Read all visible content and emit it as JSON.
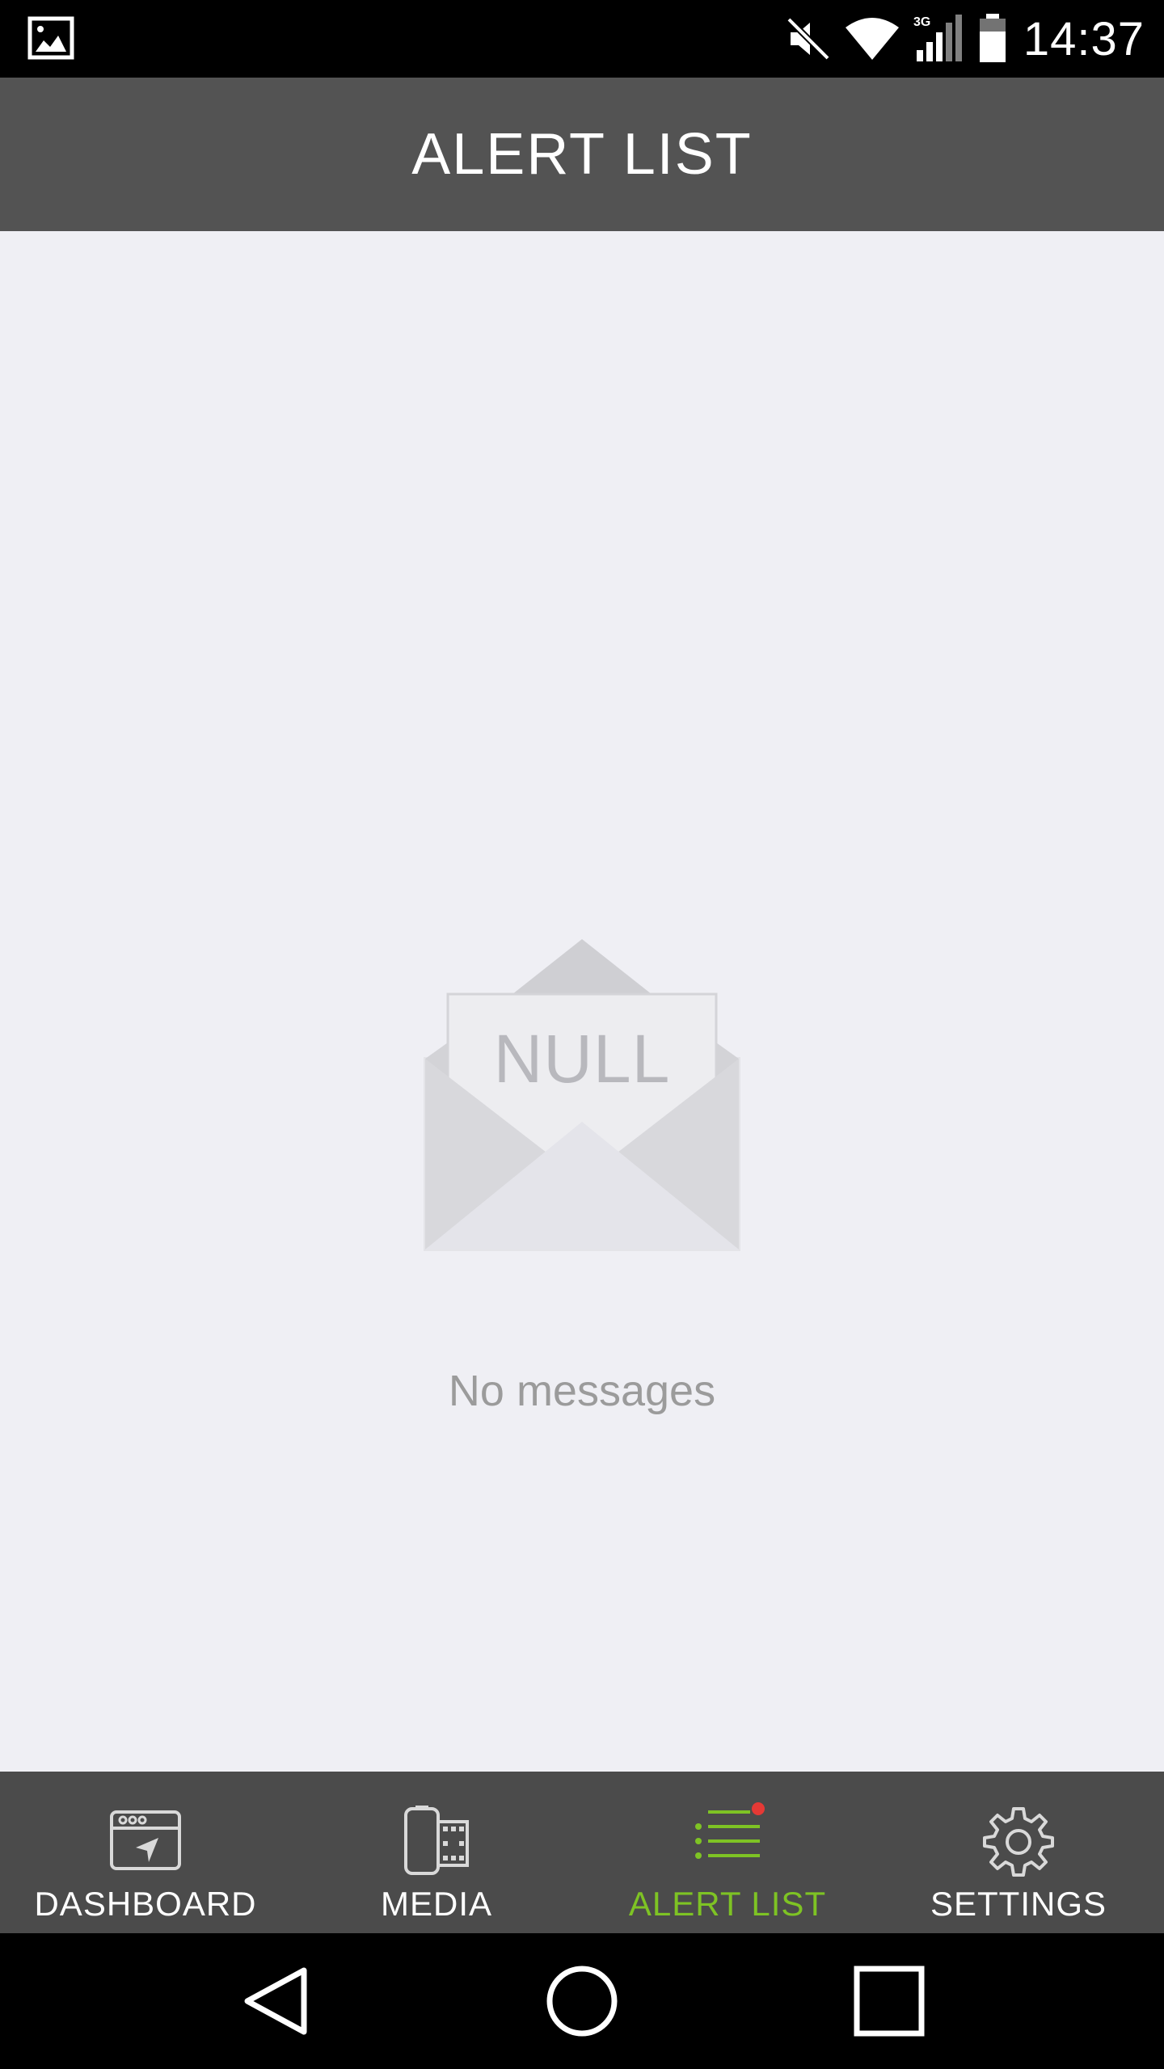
{
  "status_bar": {
    "time": "14:37",
    "network": "3G",
    "icons": [
      "gallery-notification-icon",
      "mute-icon",
      "wifi-icon",
      "signal-icon",
      "battery-icon"
    ]
  },
  "header": {
    "title": "ALERT LIST"
  },
  "empty_state": {
    "illustration_text": "NULL",
    "message": "No messages"
  },
  "tabs": [
    {
      "label": "DASHBOARD",
      "icon": "dashboard-icon",
      "active": false
    },
    {
      "label": "MEDIA",
      "icon": "media-icon",
      "active": false
    },
    {
      "label": "ALERT LIST",
      "icon": "alert-list-icon",
      "active": true,
      "badge": true
    },
    {
      "label": "SETTINGS",
      "icon": "settings-icon",
      "active": false
    }
  ],
  "colors": {
    "header_bg": "#535353",
    "content_bg": "#efeff4",
    "tab_bar_bg": "#4b4b4b",
    "accent": "#7ec324",
    "badge": "#e53935"
  },
  "nav_bar": {
    "buttons": [
      "back-icon",
      "home-icon",
      "recents-icon"
    ]
  }
}
